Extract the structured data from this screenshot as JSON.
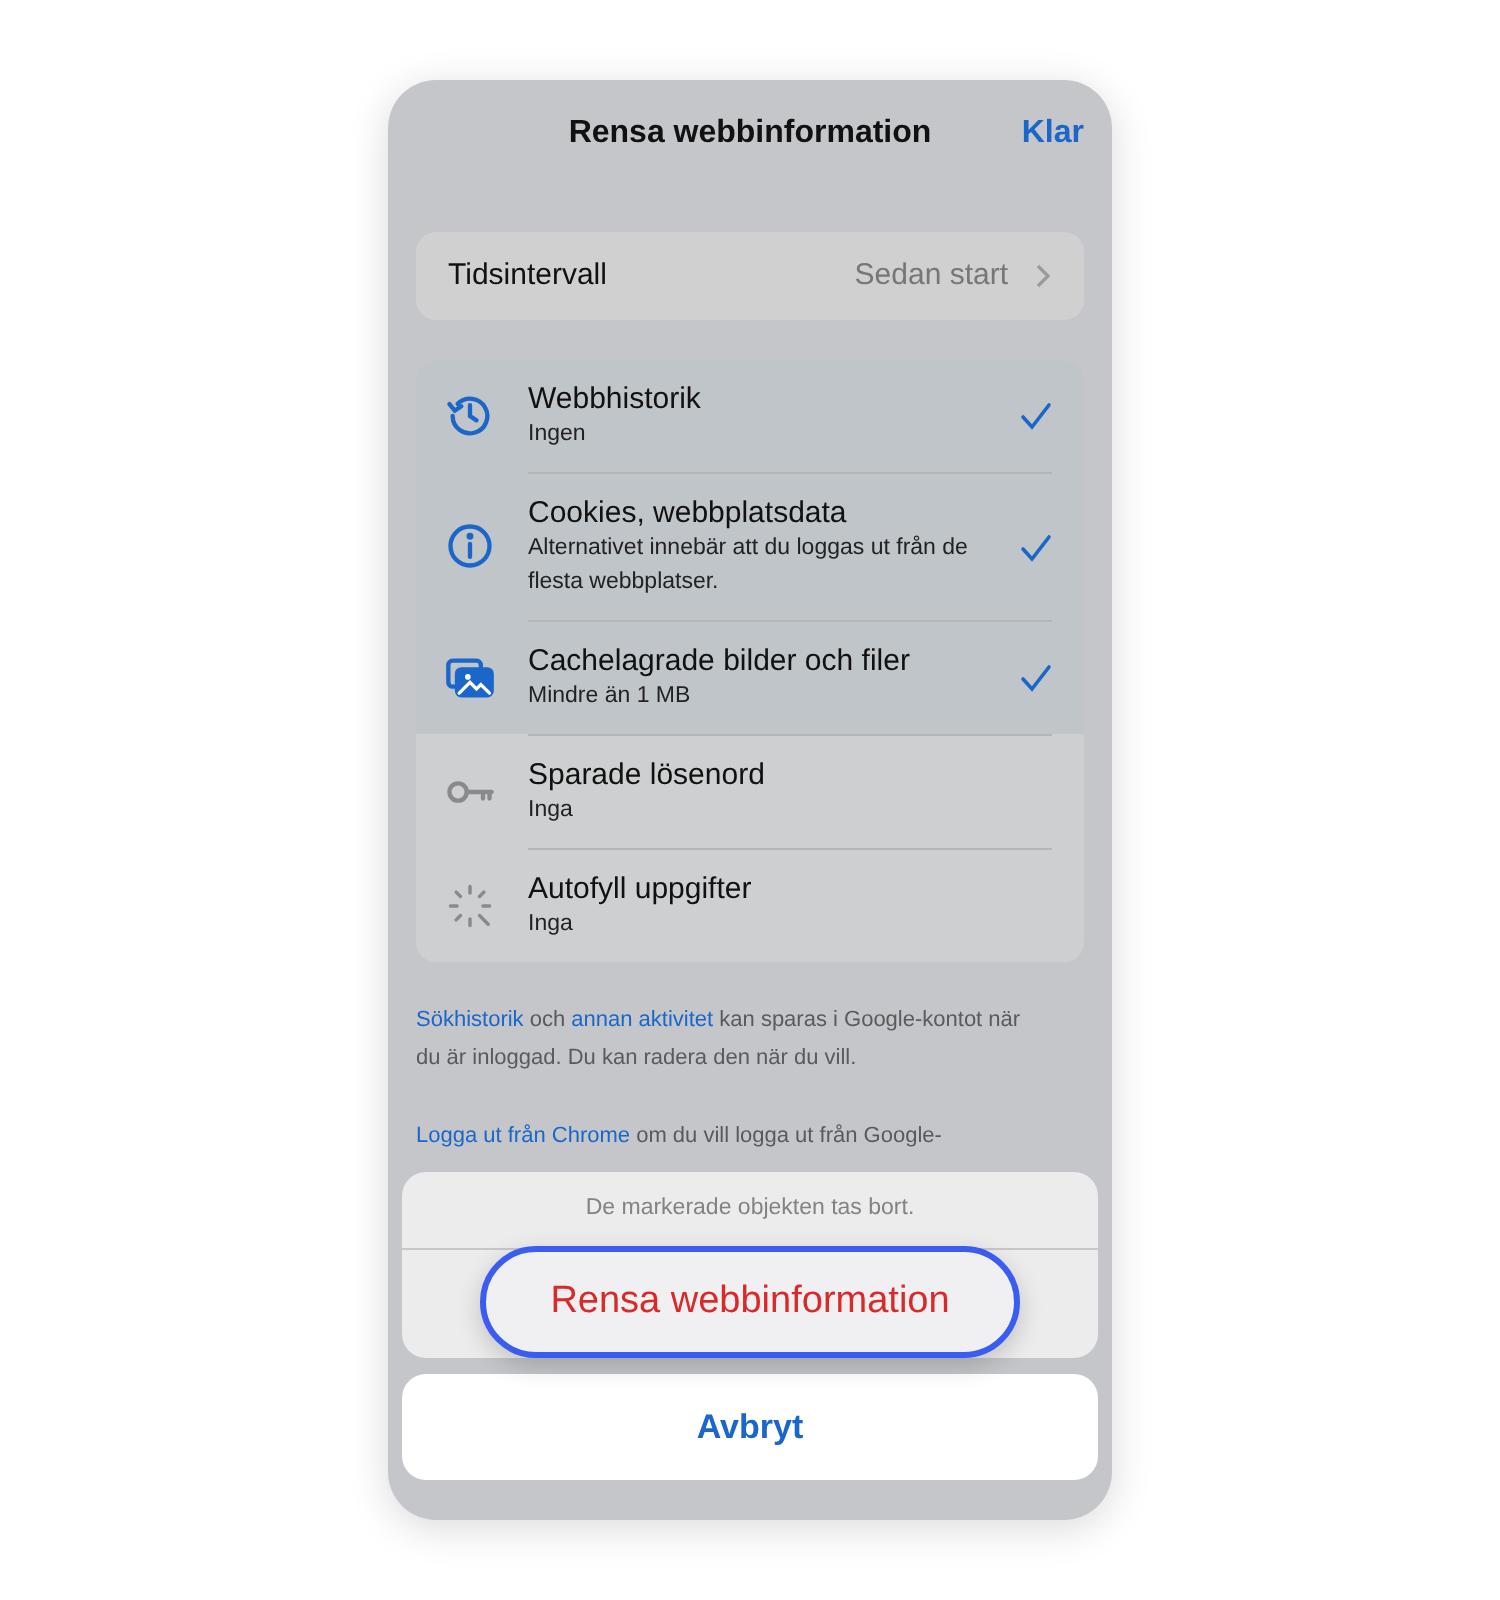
{
  "header": {
    "title": "Rensa webbinformation",
    "done": "Klar"
  },
  "time_range": {
    "label": "Tidsintervall",
    "value": "Sedan start"
  },
  "items": [
    {
      "kind": "history",
      "title": "Webbhistorik",
      "subtitle": "Ingen",
      "checked": true
    },
    {
      "kind": "info",
      "title": "Cookies, webbplatsdata",
      "subtitle": "Alternativet innebär att du loggas ut från de flesta webbplatser.",
      "checked": true
    },
    {
      "kind": "images",
      "title": "Cachelagrade bilder och filer",
      "subtitle": "Mindre än 1 MB",
      "checked": true
    },
    {
      "kind": "key",
      "title": "Sparade lösenord",
      "subtitle": "Inga",
      "checked": false
    },
    {
      "kind": "autofill",
      "title": "Autofyll uppgifter",
      "subtitle": "Inga",
      "checked": false
    }
  ],
  "notes": [
    [
      {
        "text": "Sökhistorik",
        "link": true
      },
      {
        "text": " och ",
        "link": false
      },
      {
        "text": "annan aktivitet",
        "link": true
      },
      {
        "text": " kan sparas i Google-kontot när du är inloggad. Du kan radera den när du vill.",
        "link": false
      }
    ],
    [
      {
        "text": "Logga ut från Chrome",
        "link": true
      },
      {
        "text": " om du vill logga ut från Google-",
        "link": false
      }
    ]
  ],
  "action_sheet": {
    "message": "De markerade objekten tas bort.",
    "confirm": "Rensa webbinformation",
    "cancel": "Avbryt"
  }
}
